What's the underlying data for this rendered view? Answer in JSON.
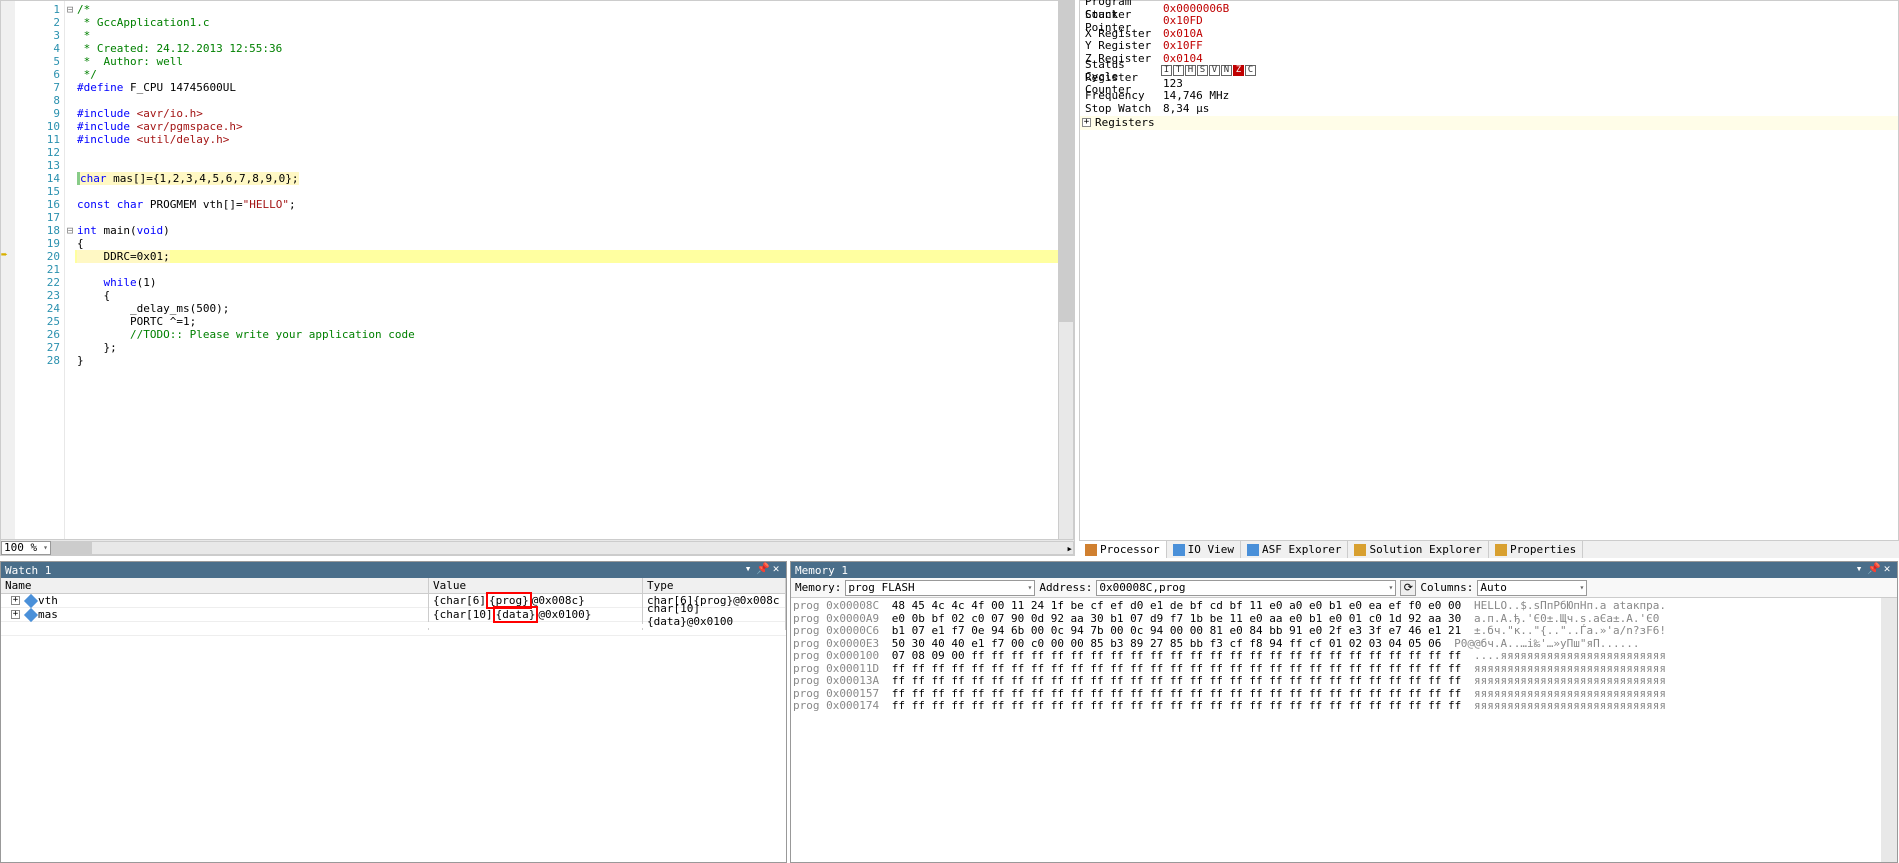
{
  "editor": {
    "zoom": "100 %",
    "lines": [
      {
        "n": 1,
        "fold": "⊟",
        "html": "<span class='c-comment'>/*</span>"
      },
      {
        "n": 2,
        "html": "<span class='c-comment'> * GccApplication1.c</span>"
      },
      {
        "n": 3,
        "html": "<span class='c-comment'> *</span>"
      },
      {
        "n": 4,
        "html": "<span class='c-comment'> * Created: 24.12.2013 12:55:36</span>"
      },
      {
        "n": 5,
        "html": "<span class='c-comment'> *  Author: well</span>"
      },
      {
        "n": 6,
        "html": "<span class='c-comment'> */</span>"
      },
      {
        "n": 7,
        "html": "<span class='c-keyword'>#define</span> F_CPU 14745600UL"
      },
      {
        "n": 8,
        "html": ""
      },
      {
        "n": 9,
        "html": "<span class='c-keyword'>#include</span> <span class='c-pp'>&lt;avr/io.h&gt;</span>"
      },
      {
        "n": 10,
        "html": "<span class='c-keyword'>#include</span> <span class='c-pp'>&lt;avr/pgmspace.h&gt;</span>"
      },
      {
        "n": 11,
        "html": "<span class='c-keyword'>#include</span> <span class='c-pp'>&lt;util/delay.h&gt;</span>"
      },
      {
        "n": 12,
        "html": ""
      },
      {
        "n": 13,
        "html": ""
      },
      {
        "n": 14,
        "hl": true,
        "html": "<span class='c-type'>char</span> mas[]={1,2,3,4,5,6,7,8,9,0};"
      },
      {
        "n": 15,
        "hl": true,
        "html": ""
      },
      {
        "n": 16,
        "html": "<span class='c-type'>const char</span> PROGMEM vth[]=<span class='c-string'>\"HELLO\"</span>;"
      },
      {
        "n": 17,
        "html": ""
      },
      {
        "n": 18,
        "fold": "⊟",
        "html": "<span class='c-type'>int</span> main(<span class='c-type'>void</span>)"
      },
      {
        "n": 19,
        "html": "{"
      },
      {
        "n": 20,
        "marker": "→",
        "hlLine": true,
        "html": "    DDRC=0x01;"
      },
      {
        "n": 21,
        "html": ""
      },
      {
        "n": 22,
        "html": "    <span class='c-keyword'>while</span>(1)"
      },
      {
        "n": 23,
        "html": "    {"
      },
      {
        "n": 24,
        "html": "        _delay_ms(500);"
      },
      {
        "n": 25,
        "html": "        PORTC ^=1;"
      },
      {
        "n": 26,
        "html": "        <span class='c-comment'>//TODO:: Please write your application code</span>"
      },
      {
        "n": 27,
        "html": "    };"
      },
      {
        "n": 28,
        "html": "}"
      }
    ]
  },
  "debug": {
    "rows": [
      {
        "label": "Program Counter",
        "value": "0x0000006B",
        "red": true
      },
      {
        "label": "Stack Pointer",
        "value": "0x10FD",
        "red": true
      },
      {
        "label": "X Register",
        "value": "0x010A",
        "red": true
      },
      {
        "label": "Y Register",
        "value": "0x10FF",
        "red": true
      },
      {
        "label": "Z Register",
        "value": "0x0104",
        "red": true
      },
      {
        "label": "Status Register",
        "flags": [
          "I",
          "T",
          "H",
          "S",
          "V",
          "N",
          "Z",
          "C"
        ],
        "on": [
          6
        ]
      },
      {
        "label": "Cycle Counter",
        "value": "123"
      },
      {
        "label": "Frequency",
        "value": "14,746 MHz"
      },
      {
        "label": "Stop Watch",
        "value": "8,34 µs"
      }
    ],
    "registers_label": "Registers"
  },
  "right_tabs": [
    {
      "icon": "#d08030",
      "label": "Processor",
      "active": true
    },
    {
      "icon": "#4a90d9",
      "label": "IO View"
    },
    {
      "icon": "#4a90d9",
      "label": "ASF Explorer"
    },
    {
      "icon": "#d8a030",
      "label": "Solution Explorer"
    },
    {
      "icon": "#d8a030",
      "label": "Properties"
    }
  ],
  "watch": {
    "title": "Watch 1",
    "cols": {
      "name": "Name",
      "value": "Value",
      "type": "Type"
    },
    "rows": [
      {
        "name": "vth",
        "value_pre": "{char[6]",
        "value_box": "{prog}",
        "value_post": "@0x008c}",
        "type": "char[6]{prog}@0x008c"
      },
      {
        "name": "mas",
        "value_pre": "{char[10]",
        "value_box": "{data}",
        "value_post": "@0x0100}",
        "type": "char[10]{data}@0x0100"
      }
    ]
  },
  "memory": {
    "title": "Memory 1",
    "toolbar": {
      "memory_label": "Memory:",
      "memory_val": "prog FLASH",
      "address_label": "Address:",
      "address_val": "0x00008C,prog",
      "columns_label": "Columns:",
      "columns_val": "Auto"
    },
    "lines": [
      {
        "addr": "prog 0x00008C",
        "hex": "48 45 4c 4c 4f 00 11 24 1f be cf ef d0 e1 de bf cd bf 11 e0 a0 e0 b1 e0 ea ef f0 e0 00",
        "ascii": "HELLO..$.ѕПпРбЮпНп.а аtакпра."
      },
      {
        "addr": "prog 0x0000A9",
        "hex": "e0 0b bf 02 c0 07 90 0d 92 aa 30 b1 07 d9 f7 1b be 11 e0 aa e0 b1 e0 01 c0 1d 92 aa 30",
        "ascii": "а.п.А.ђ.'Є0±.Щч.s.аЄа±.А.'Є0"
      },
      {
        "addr": "prog 0x0000C6",
        "hex": "b1 07 e1 f7 0e 94 6b 00 0c 94 7b 00 0c 94 00 00 81 e0 84 bb 91 e0 2f e3 3f e7 46 e1 21",
        "ascii": "±.бч.\"к..\"{..\"..Ѓа.»'а/n?зF6!"
      },
      {
        "addr": "prog 0x0000E3",
        "hex": "50 30 40 40 e1 f7 00 c0 00 00 85 b3 89 27 85 bb f3 cf f8 94 ff cf 01 02 03 04 05 06",
        "ascii": "Р0@@бч.А..…і‰'…»уПш\"яП......"
      },
      {
        "addr": "prog 0x000100",
        "hex": "07 08 09 00 ff ff ff ff ff ff ff ff ff ff ff ff ff ff ff ff ff ff ff ff ff ff ff ff ff",
        "ascii": "....яяяяяяяяяяяяяяяяяяяяяяяяя"
      },
      {
        "addr": "prog 0x00011D",
        "hex": "ff ff ff ff ff ff ff ff ff ff ff ff ff ff ff ff ff ff ff ff ff ff ff ff ff ff ff ff ff",
        "ascii": "яяяяяяяяяяяяяяяяяяяяяяяяяяяяя"
      },
      {
        "addr": "prog 0x00013A",
        "hex": "ff ff ff ff ff ff ff ff ff ff ff ff ff ff ff ff ff ff ff ff ff ff ff ff ff ff ff ff ff",
        "ascii": "яяяяяяяяяяяяяяяяяяяяяяяяяяяяя"
      },
      {
        "addr": "prog 0x000157",
        "hex": "ff ff ff ff ff ff ff ff ff ff ff ff ff ff ff ff ff ff ff ff ff ff ff ff ff ff ff ff ff",
        "ascii": "яяяяяяяяяяяяяяяяяяяяяяяяяяяяя"
      },
      {
        "addr": "prog 0x000174",
        "hex": "ff ff ff ff ff ff ff ff ff ff ff ff ff ff ff ff ff ff ff ff ff ff ff ff ff ff ff ff ff",
        "ascii": "яяяяяяяяяяяяяяяяяяяяяяяяяяяяя"
      }
    ]
  }
}
